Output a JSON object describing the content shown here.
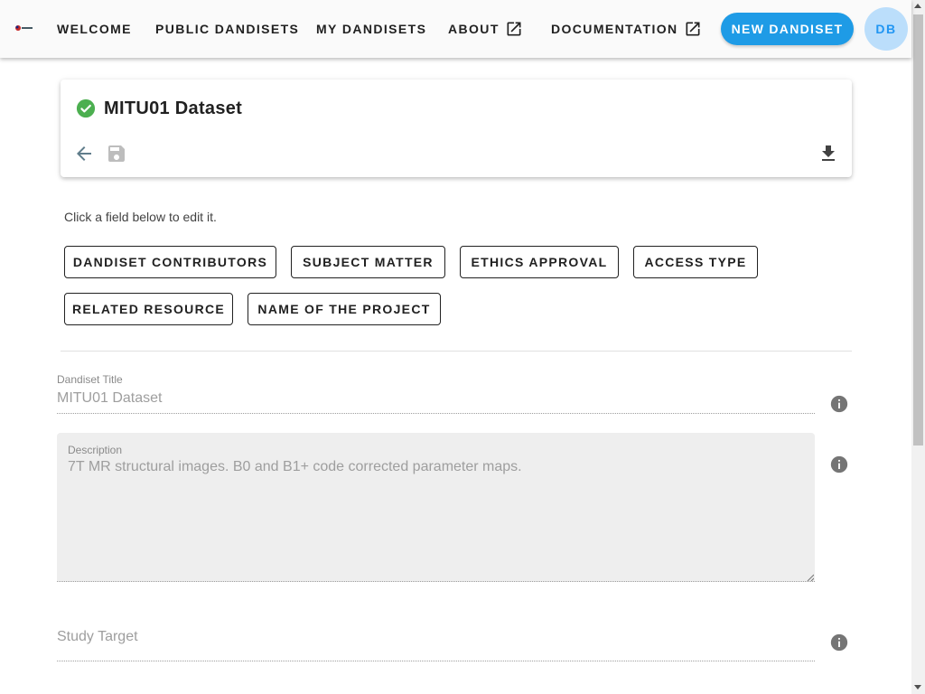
{
  "nav": {
    "links": [
      {
        "label": "WELCOME"
      },
      {
        "label": "PUBLIC DANDISETS"
      },
      {
        "label": "MY DANDISETS"
      },
      {
        "label": "ABOUT"
      },
      {
        "label": "DOCUMENTATION"
      }
    ],
    "new_dandiset_label": "NEW DANDISET",
    "avatar_initials": "DB"
  },
  "colors": {
    "accent": "#1e9be6",
    "avatar_bg": "#bbdefb",
    "success": "#4caf50",
    "icon_grey": "#607d8b"
  },
  "card": {
    "title": "MITU01 Dataset",
    "status_icon": "check-circle-icon",
    "icons": [
      "arrow-left-icon",
      "save-icon",
      "download-icon"
    ]
  },
  "editor": {
    "hint": "Click a field below to edit it.",
    "field_buttons": [
      "DANDISET CONTRIBUTORS",
      "SUBJECT MATTER",
      "ETHICS APPROVAL",
      "ACCESS TYPE",
      "RELATED RESOURCE",
      "NAME OF THE PROJECT"
    ]
  },
  "form": {
    "title_label": "Dandiset Title",
    "title_value": "MITU01 Dataset",
    "description_label": "Description",
    "description_value": "7T MR structural images. B0 and B1+ code corrected parameter maps.",
    "study_target_label": "Study Target",
    "study_target_value": ""
  }
}
